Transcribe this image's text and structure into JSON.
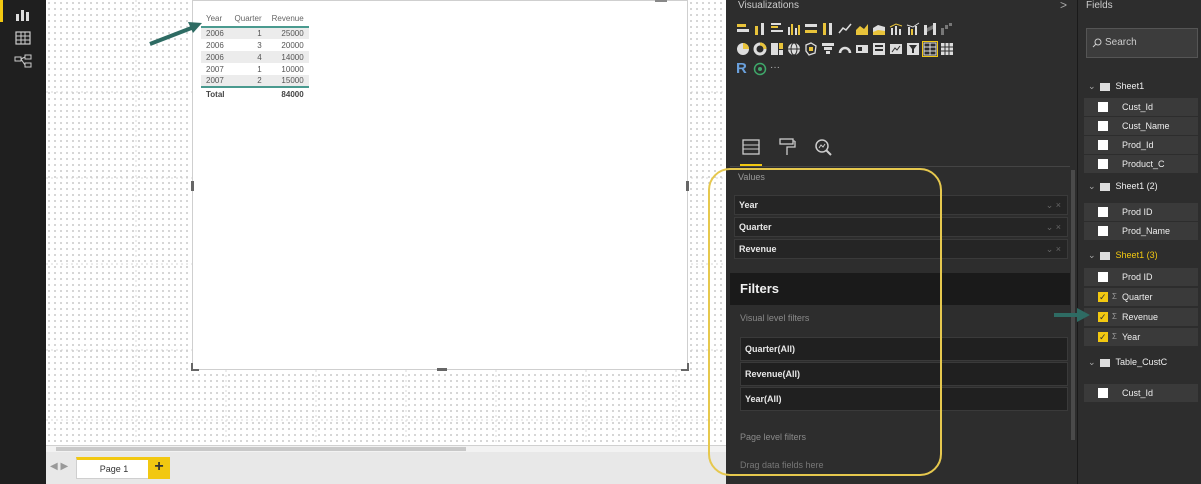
{
  "rail": {
    "icons": [
      "report-view-icon",
      "data-view-icon",
      "relationship-view-icon"
    ]
  },
  "table": {
    "headers": [
      "Year",
      "Quarter",
      "Revenue"
    ],
    "rows": [
      [
        "2006",
        "1",
        "25000"
      ],
      [
        "2006",
        "3",
        "20000"
      ],
      [
        "2006",
        "4",
        "14000"
      ],
      [
        "2007",
        "1",
        "10000"
      ],
      [
        "2007",
        "2",
        "15000"
      ]
    ],
    "total_label": "Total",
    "total_value": "84000"
  },
  "pages": {
    "nav": "◀ ▶",
    "tab_label": "Page 1",
    "add_label": "+"
  },
  "visualizations": {
    "title": "Visualizations",
    "collapse": ">",
    "more": "···",
    "r_label": "R",
    "values_label": "Values",
    "wells": [
      "Year",
      "Quarter",
      "Revenue"
    ],
    "well_controls": "⌄ ×",
    "filters_title": "Filters",
    "visual_level_label": "Visual level filters",
    "filters": [
      "Quarter(All)",
      "Revenue(All)",
      "Year(All)"
    ],
    "page_level_label": "Page level filters",
    "drag_text": "Drag data fields here"
  },
  "fields": {
    "title": "Fields",
    "search_placeholder": "Search",
    "tables": [
      {
        "name": "Sheet1",
        "fields": [
          {
            "label": "Cust_Id",
            "checked": false
          },
          {
            "label": "Cust_Name",
            "checked": false
          },
          {
            "label": "Prod_Id",
            "checked": false
          },
          {
            "label": "Product_C",
            "checked": false
          }
        ]
      },
      {
        "name": "Sheet1 (2)",
        "fields": [
          {
            "label": "Prod ID",
            "checked": false
          },
          {
            "label": "Prod_Name",
            "checked": false
          }
        ]
      },
      {
        "name": "Sheet1 (3)",
        "fields": [
          {
            "label": "Prod ID",
            "checked": false
          },
          {
            "label": "Quarter",
            "checked": true
          },
          {
            "label": "Revenue",
            "checked": true
          },
          {
            "label": "Year",
            "checked": true
          }
        ]
      },
      {
        "name": "Table_CustC",
        "fields": [
          {
            "label": "Cust_Id",
            "checked": false
          }
        ]
      }
    ]
  },
  "colors": {
    "accent": "#f2c811",
    "pane": "#2d2d2d",
    "annotation_arrow": "#2e6b63",
    "highlight_circle": "#e6c84e"
  }
}
